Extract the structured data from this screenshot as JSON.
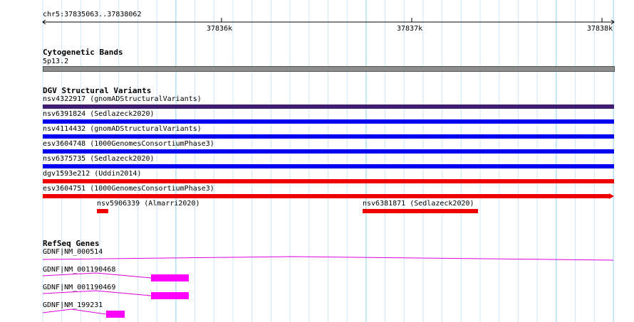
{
  "ruler": {
    "region": "chr5:37835063..37838062",
    "ticks": [
      "37836k",
      "37837k",
      "37838k"
    ]
  },
  "cytoband": {
    "title": "Cytogenetic Bands",
    "band": "5p13.2"
  },
  "dgv": {
    "title": "DGV Structural Variants",
    "variants": [
      {
        "label": "nsv4322917 (gnomADStructuralVariants)",
        "color": "#3d1c72"
      },
      {
        "label": "nsv6391824 (Sedlazeck2020)",
        "color": "#0000ee"
      },
      {
        "label": "nsv4114432 (gnomADStructuralVariants)",
        "color": "#0000ee"
      },
      {
        "label": "esv3604748 (1000GenomesConsortiumPhase3)",
        "color": "#0000ee"
      },
      {
        "label": "nsv6375735 (Sedlazeck2020)",
        "color": "#0000ee"
      },
      {
        "label": "dgv1593e212 (Uddin2014)",
        "color": "#ee0000"
      },
      {
        "label": "esv3604751 (1000GenomesConsortiumPhase3)",
        "color": "#ee0000"
      }
    ],
    "small": [
      {
        "label": "nsv5906339 (Almarri2020)",
        "color": "#ee0000"
      },
      {
        "label": "nsv6381871 (Sedlazeck2020)",
        "color": "#ee0000"
      }
    ]
  },
  "refseq": {
    "title": "RefSeq Genes",
    "genes": [
      {
        "label": "GDNF|NM_000514"
      },
      {
        "label": "GDNF|NM_001190468"
      },
      {
        "label": "GDNF|NM_001190469"
      },
      {
        "label": "GDNF|NM_199231"
      }
    ]
  }
}
